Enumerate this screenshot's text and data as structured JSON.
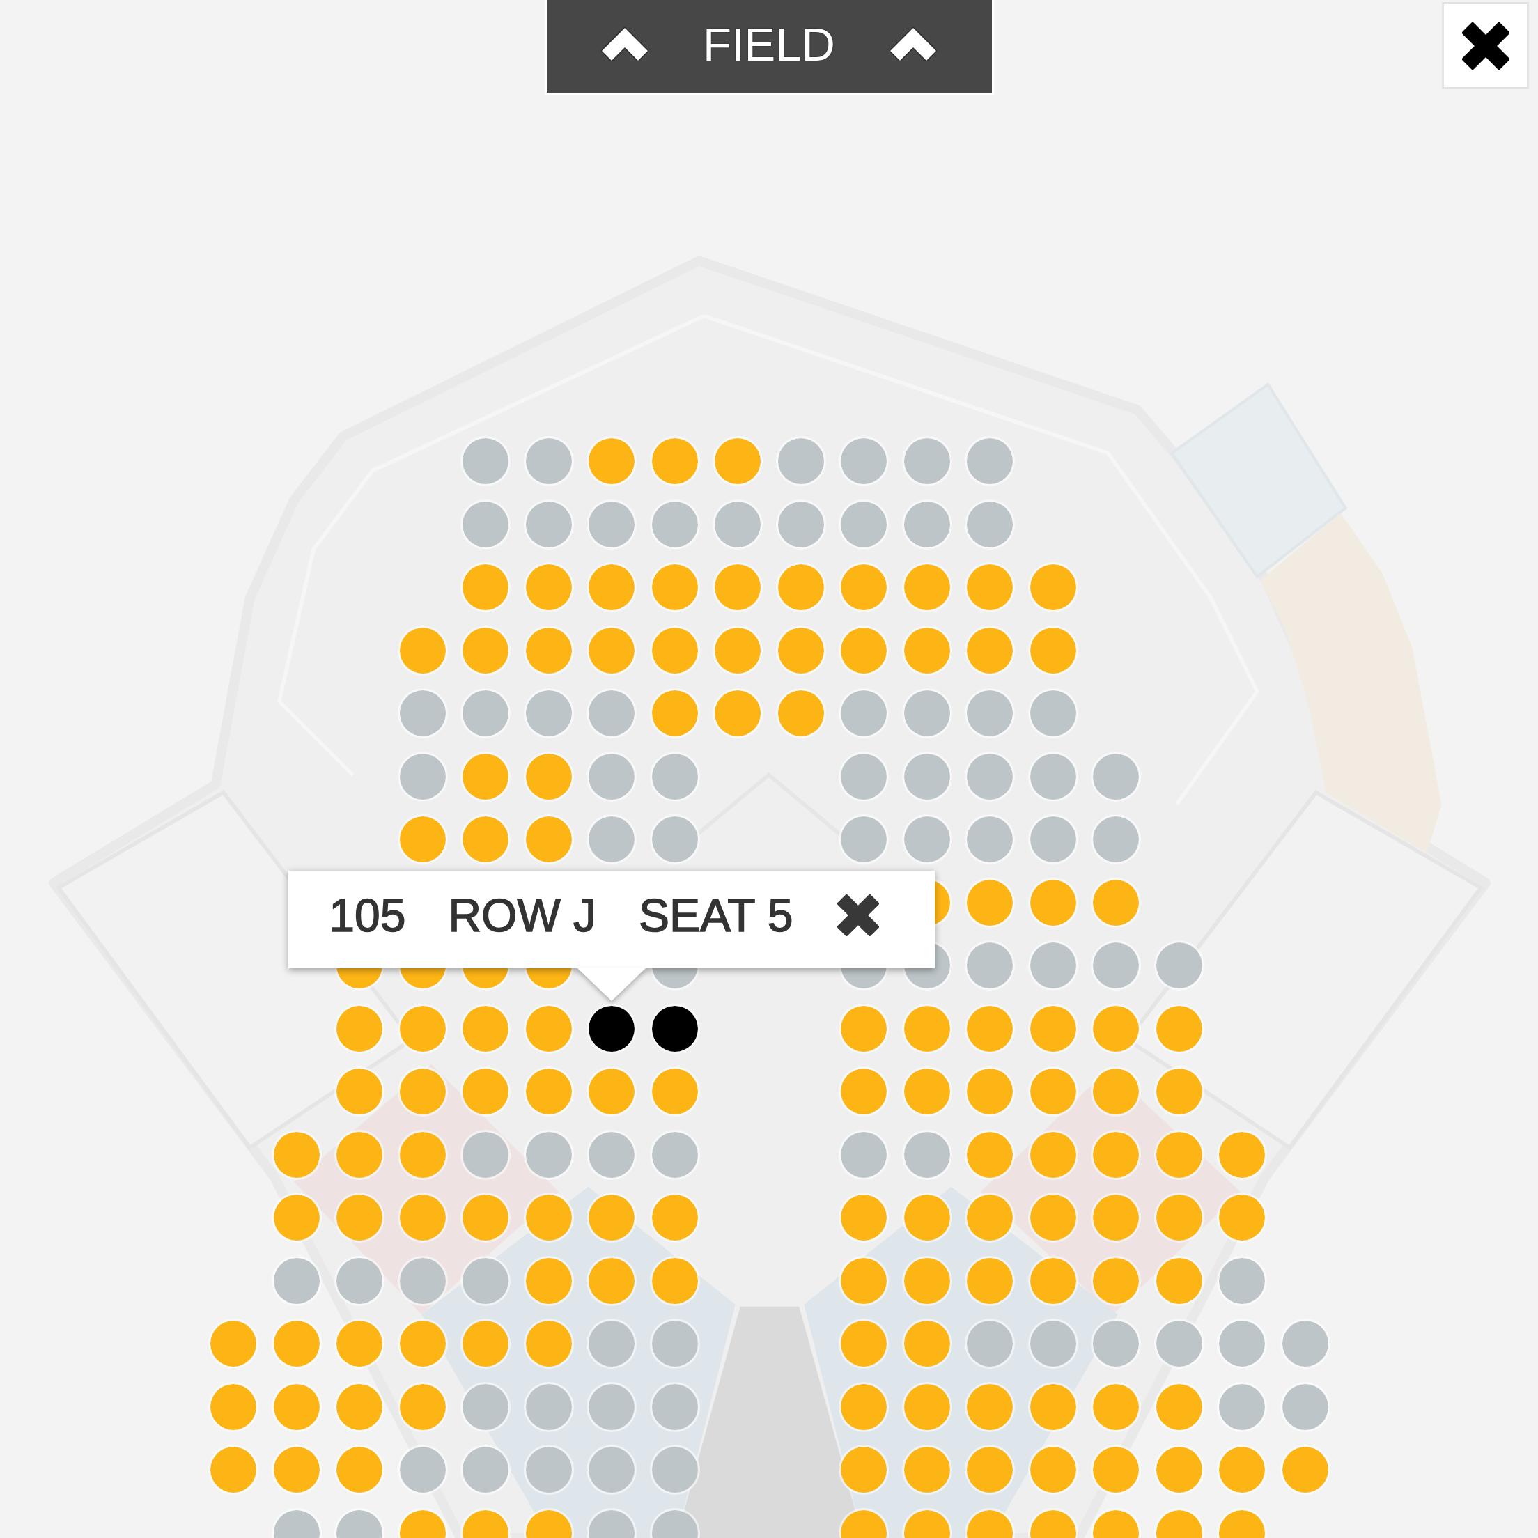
{
  "field_banner": {
    "label": "FIELD"
  },
  "rows": [
    {
      "blocks": [
        {
          "seats": [
            {
              "available": false,
              "selected": false
            },
            {
              "available": false,
              "selected": false
            },
            {
              "available": true,
              "selected": false
            },
            {
              "available": true,
              "selected": false
            },
            {
              "available": true,
              "selected": false
            },
            {
              "available": false,
              "selected": false
            },
            {
              "available": false,
              "selected": false
            },
            {
              "available": false,
              "selected": false
            },
            {
              "available": false,
              "selected": false
            }
          ]
        }
      ]
    },
    {
      "blocks": [
        {
          "seats": [
            {
              "available": false,
              "selected": false
            },
            {
              "available": false,
              "selected": false
            },
            {
              "available": false,
              "selected": false
            },
            {
              "available": false,
              "selected": false
            },
            {
              "available": false,
              "selected": false
            },
            {
              "available": false,
              "selected": false
            },
            {
              "available": false,
              "selected": false
            },
            {
              "available": false,
              "selected": false
            },
            {
              "available": false,
              "selected": false
            }
          ]
        }
      ]
    },
    {
      "blocks": [
        {
          "seats": [
            {
              "available": true,
              "selected": false
            },
            {
              "available": true,
              "selected": false
            },
            {
              "available": true,
              "selected": false
            },
            {
              "available": true,
              "selected": false
            },
            {
              "available": true,
              "selected": false
            },
            {
              "available": true,
              "selected": false
            },
            {
              "available": true,
              "selected": false
            },
            {
              "available": true,
              "selected": false
            },
            {
              "available": true,
              "selected": false
            },
            {
              "available": true,
              "selected": false
            }
          ]
        }
      ]
    },
    {
      "blocks": [
        {
          "seats": [
            {
              "available": true,
              "selected": false
            },
            {
              "available": true,
              "selected": false
            },
            {
              "available": true,
              "selected": false
            },
            {
              "available": true,
              "selected": false
            },
            {
              "available": true,
              "selected": false
            },
            {
              "available": true,
              "selected": false
            },
            {
              "available": true,
              "selected": false
            },
            {
              "available": true,
              "selected": false
            },
            {
              "available": true,
              "selected": false
            },
            {
              "available": true,
              "selected": false
            },
            {
              "available": true,
              "selected": false
            }
          ]
        }
      ]
    },
    {
      "blocks": [
        {
          "seats": [
            {
              "available": false,
              "selected": false
            },
            {
              "available": false,
              "selected": false
            },
            {
              "available": false,
              "selected": false
            },
            {
              "available": false,
              "selected": false
            },
            {
              "available": true,
              "selected": false
            },
            {
              "available": true,
              "selected": false
            },
            {
              "available": true,
              "selected": false
            },
            {
              "available": false,
              "selected": false
            },
            {
              "available": false,
              "selected": false
            },
            {
              "available": false,
              "selected": false
            },
            {
              "available": false,
              "selected": false
            }
          ]
        }
      ]
    },
    {
      "blocks": [
        {
          "seats": [
            {
              "available": false,
              "selected": false
            },
            {
              "available": true,
              "selected": false
            },
            {
              "available": true,
              "selected": false
            },
            {
              "available": false,
              "selected": false
            },
            {
              "available": false,
              "selected": false
            }
          ]
        },
        {
          "seats": [
            {
              "available": false,
              "selected": false
            },
            {
              "available": false,
              "selected": false
            },
            {
              "available": false,
              "selected": false
            },
            {
              "available": false,
              "selected": false
            },
            {
              "available": false,
              "selected": false
            }
          ]
        }
      ]
    },
    {
      "blocks": [
        {
          "seats": [
            {
              "available": true,
              "selected": false
            },
            {
              "available": true,
              "selected": false
            },
            {
              "available": true,
              "selected": false
            },
            {
              "available": false,
              "selected": false
            },
            {
              "available": false,
              "selected": false
            }
          ]
        },
        {
          "seats": [
            {
              "available": false,
              "selected": false
            },
            {
              "available": false,
              "selected": false
            },
            {
              "available": false,
              "selected": false
            },
            {
              "available": false,
              "selected": false
            },
            {
              "available": false,
              "selected": false
            }
          ]
        }
      ]
    },
    {
      "blocks": [
        {
          "seats": [
            {
              "available": true,
              "selected": false
            },
            {
              "available": true,
              "selected": false
            },
            {
              "available": true,
              "selected": false
            },
            {
              "available": true,
              "selected": false
            }
          ]
        }
      ]
    },
    {
      "blocks": [
        {
          "seats": [
            {
              "available": true,
              "selected": false
            },
            {
              "available": true,
              "selected": false
            },
            {
              "available": true,
              "selected": false
            },
            {
              "available": true,
              "selected": false
            }
          ]
        },
        {
          "seats": [
            {
              "available": false,
              "selected": false
            }
          ]
        },
        {
          "seats": [
            {
              "available": false,
              "selected": false
            },
            {
              "available": false,
              "selected": false
            },
            {
              "available": false,
              "selected": false
            },
            {
              "available": false,
              "selected": false
            },
            {
              "available": false,
              "selected": false
            },
            {
              "available": false,
              "selected": false
            }
          ]
        }
      ]
    },
    {
      "blocks": [
        {
          "seats": [
            {
              "available": true,
              "selected": false
            },
            {
              "available": true,
              "selected": false
            },
            {
              "available": true,
              "selected": false
            },
            {
              "available": true,
              "selected": false
            },
            {
              "available": true,
              "selected": true
            },
            {
              "available": true,
              "selected": true
            }
          ]
        },
        {
          "seats": [
            {
              "available": true,
              "selected": false
            },
            {
              "available": true,
              "selected": false
            },
            {
              "available": true,
              "selected": false
            },
            {
              "available": true,
              "selected": false
            },
            {
              "available": true,
              "selected": false
            },
            {
              "available": true,
              "selected": false
            }
          ]
        }
      ]
    },
    {
      "blocks": [
        {
          "seats": [
            {
              "available": true,
              "selected": false
            },
            {
              "available": true,
              "selected": false
            },
            {
              "available": true,
              "selected": false
            },
            {
              "available": true,
              "selected": false
            },
            {
              "available": true,
              "selected": false
            },
            {
              "available": true,
              "selected": false
            }
          ]
        },
        {
          "seats": [
            {
              "available": true,
              "selected": false
            },
            {
              "available": true,
              "selected": false
            },
            {
              "available": true,
              "selected": false
            },
            {
              "available": true,
              "selected": false
            },
            {
              "available": true,
              "selected": false
            },
            {
              "available": true,
              "selected": false
            }
          ]
        }
      ]
    },
    {
      "blocks": [
        {
          "seats": [
            {
              "available": true,
              "selected": false
            },
            {
              "available": true,
              "selected": false
            },
            {
              "available": true,
              "selected": false
            },
            {
              "available": false,
              "selected": false
            },
            {
              "available": false,
              "selected": false
            },
            {
              "available": false,
              "selected": false
            },
            {
              "available": false,
              "selected": false
            }
          ]
        },
        {
          "seats": [
            {
              "available": false,
              "selected": false
            },
            {
              "available": false,
              "selected": false
            },
            {
              "available": true,
              "selected": false
            },
            {
              "available": true,
              "selected": false
            },
            {
              "available": true,
              "selected": false
            },
            {
              "available": true,
              "selected": false
            },
            {
              "available": true,
              "selected": false
            }
          ]
        }
      ]
    },
    {
      "blocks": [
        {
          "seats": [
            {
              "available": true,
              "selected": false
            },
            {
              "available": true,
              "selected": false
            },
            {
              "available": true,
              "selected": false
            },
            {
              "available": true,
              "selected": false
            },
            {
              "available": true,
              "selected": false
            },
            {
              "available": true,
              "selected": false
            },
            {
              "available": true,
              "selected": false
            }
          ]
        },
        {
          "seats": [
            {
              "available": true,
              "selected": false
            },
            {
              "available": true,
              "selected": false
            },
            {
              "available": true,
              "selected": false
            },
            {
              "available": true,
              "selected": false
            },
            {
              "available": true,
              "selected": false
            },
            {
              "available": true,
              "selected": false
            },
            {
              "available": true,
              "selected": false
            }
          ]
        }
      ]
    },
    {
      "blocks": [
        {
          "seats": [
            {
              "available": false,
              "selected": false
            },
            {
              "available": false,
              "selected": false
            },
            {
              "available": false,
              "selected": false
            },
            {
              "available": false,
              "selected": false
            },
            {
              "available": true,
              "selected": false
            },
            {
              "available": true,
              "selected": false
            },
            {
              "available": true,
              "selected": false
            }
          ]
        },
        {
          "seats": [
            {
              "available": true,
              "selected": false
            },
            {
              "available": true,
              "selected": false
            },
            {
              "available": true,
              "selected": false
            },
            {
              "available": true,
              "selected": false
            },
            {
              "available": true,
              "selected": false
            },
            {
              "available": true,
              "selected": false
            },
            {
              "available": false,
              "selected": false
            }
          ]
        }
      ]
    },
    {
      "blocks": [
        {
          "seats": [
            {
              "available": true,
              "selected": false
            },
            {
              "available": true,
              "selected": false
            },
            {
              "available": true,
              "selected": false
            },
            {
              "available": true,
              "selected": false
            },
            {
              "available": true,
              "selected": false
            },
            {
              "available": true,
              "selected": false
            },
            {
              "available": false,
              "selected": false
            },
            {
              "available": false,
              "selected": false
            }
          ]
        },
        {
          "seats": [
            {
              "available": true,
              "selected": false
            },
            {
              "available": true,
              "selected": false
            },
            {
              "available": false,
              "selected": false
            },
            {
              "available": false,
              "selected": false
            },
            {
              "available": false,
              "selected": false
            },
            {
              "available": false,
              "selected": false
            },
            {
              "available": false,
              "selected": false
            },
            {
              "available": false,
              "selected": false
            }
          ]
        }
      ]
    },
    {
      "blocks": [
        {
          "seats": [
            {
              "available": true,
              "selected": false
            },
            {
              "available": true,
              "selected": false
            },
            {
              "available": true,
              "selected": false
            },
            {
              "available": true,
              "selected": false
            },
            {
              "available": false,
              "selected": false
            },
            {
              "available": false,
              "selected": false
            },
            {
              "available": false,
              "selected": false
            },
            {
              "available": false,
              "selected": false
            }
          ]
        },
        {
          "seats": [
            {
              "available": true,
              "selected": false
            },
            {
              "available": true,
              "selected": false
            },
            {
              "available": true,
              "selected": false
            },
            {
              "available": true,
              "selected": false
            },
            {
              "available": true,
              "selected": false
            },
            {
              "available": true,
              "selected": false
            },
            {
              "available": false,
              "selected": false
            },
            {
              "available": false,
              "selected": false
            }
          ]
        }
      ]
    },
    {
      "blocks": [
        {
          "seats": [
            {
              "available": true,
              "selected": false
            },
            {
              "available": true,
              "selected": false
            },
            {
              "available": true,
              "selected": false
            },
            {
              "available": false,
              "selected": false
            },
            {
              "available": false,
              "selected": false
            },
            {
              "available": false,
              "selected": false
            },
            {
              "available": false,
              "selected": false
            },
            {
              "available": false,
              "selected": false
            }
          ]
        },
        {
          "seats": [
            {
              "available": true,
              "selected": false
            },
            {
              "available": true,
              "selected": false
            },
            {
              "available": true,
              "selected": false
            },
            {
              "available": true,
              "selected": false
            },
            {
              "available": true,
              "selected": false
            },
            {
              "available": true,
              "selected": false
            },
            {
              "available": true,
              "selected": false
            },
            {
              "available": true,
              "selected": false
            }
          ]
        }
      ]
    },
    {
      "blocks": [
        {
          "seats": [
            {
              "available": false,
              "selected": false
            },
            {
              "available": false,
              "selected": false
            },
            {
              "available": true,
              "selected": false
            },
            {
              "available": true,
              "selected": false
            },
            {
              "available": true,
              "selected": false
            },
            {
              "available": false,
              "selected": false
            },
            {
              "available": false,
              "selected": false
            }
          ]
        },
        {
          "seats": [
            {
              "available": true,
              "selected": false
            },
            {
              "available": true,
              "selected": false
            },
            {
              "available": true,
              "selected": false
            },
            {
              "available": true,
              "selected": false
            },
            {
              "available": true,
              "selected": false
            },
            {
              "available": true,
              "selected": false
            },
            {
              "available": true,
              "selected": false
            }
          ]
        }
      ]
    }
  ],
  "seat_popup": {
    "section": "105",
    "row": "ROW J",
    "seat": "SEAT 5"
  }
}
